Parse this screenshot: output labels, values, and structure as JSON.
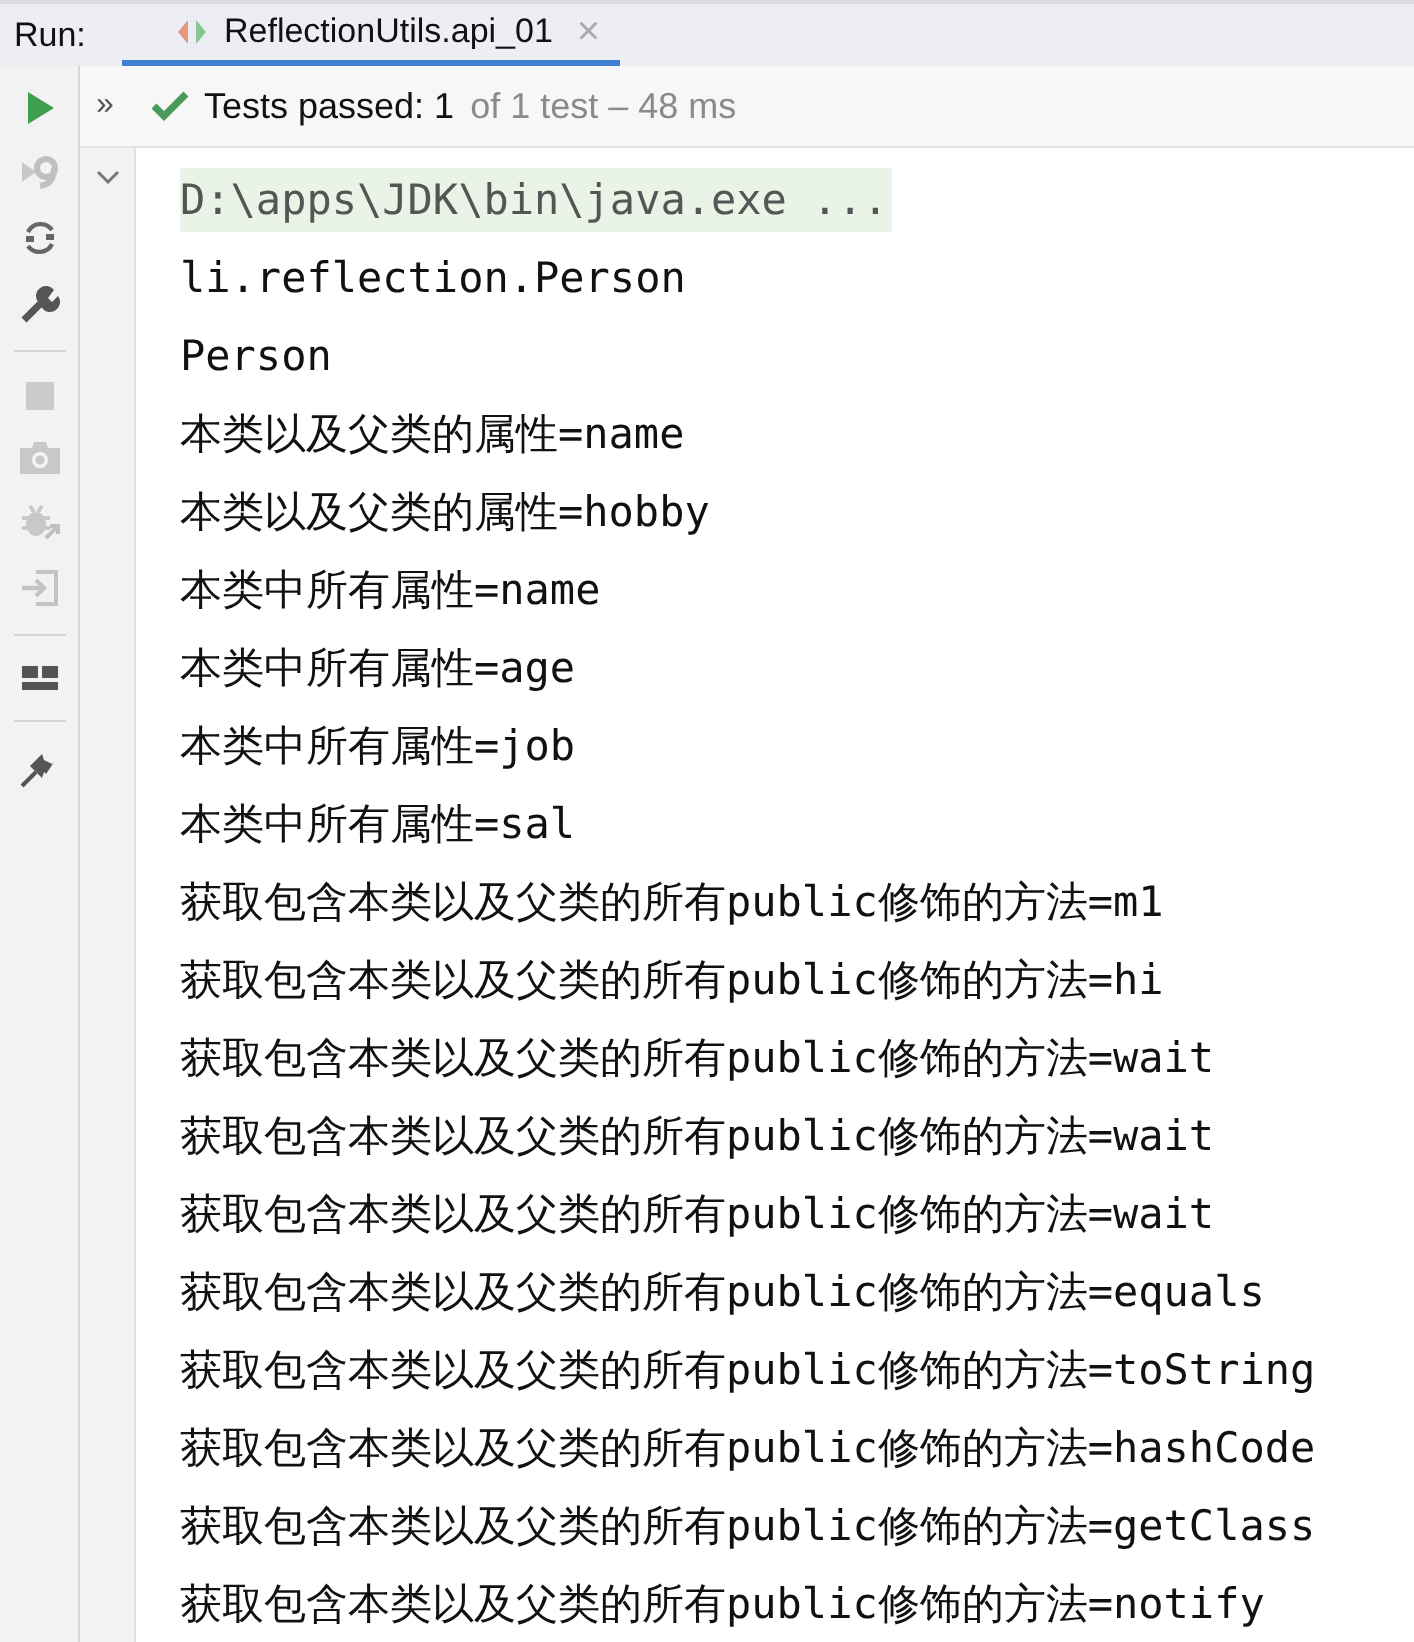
{
  "run_bar": {
    "label": "Run:",
    "tabs": [
      {
        "title": "ReflectionUtils.api_01",
        "selected": true,
        "close": "×"
      }
    ]
  },
  "status": {
    "expander": "»",
    "passed": "Tests passed: 1",
    "detail": "of 1 test – 48 ms"
  },
  "console": {
    "expanded": true,
    "lines": [
      {
        "kind": "command",
        "text": "D:\\apps\\JDK\\bin\\java.exe ..."
      },
      {
        "kind": "output",
        "text": "li.reflection.Person"
      },
      {
        "kind": "output",
        "text": "Person"
      },
      {
        "kind": "output",
        "text": "本类以及父类的属性=name"
      },
      {
        "kind": "output",
        "text": "本类以及父类的属性=hobby"
      },
      {
        "kind": "output",
        "text": "本类中所有属性=name"
      },
      {
        "kind": "output",
        "text": "本类中所有属性=age"
      },
      {
        "kind": "output",
        "text": "本类中所有属性=job"
      },
      {
        "kind": "output",
        "text": "本类中所有属性=sal"
      },
      {
        "kind": "output",
        "text": "获取包含本类以及父类的所有public修饰的方法=m1"
      },
      {
        "kind": "output",
        "text": "获取包含本类以及父类的所有public修饰的方法=hi"
      },
      {
        "kind": "output",
        "text": "获取包含本类以及父类的所有public修饰的方法=wait"
      },
      {
        "kind": "output",
        "text": "获取包含本类以及父类的所有public修饰的方法=wait"
      },
      {
        "kind": "output",
        "text": "获取包含本类以及父类的所有public修饰的方法=wait"
      },
      {
        "kind": "output",
        "text": "获取包含本类以及父类的所有public修饰的方法=equals"
      },
      {
        "kind": "output",
        "text": "获取包含本类以及父类的所有public修饰的方法=toString"
      },
      {
        "kind": "output",
        "text": "获取包含本类以及父类的所有public修饰的方法=hashCode"
      },
      {
        "kind": "output",
        "text": "获取包含本类以及父类的所有public修饰的方法=getClass"
      },
      {
        "kind": "output",
        "text": "获取包含本类以及父类的所有public修饰的方法=notify"
      }
    ]
  }
}
